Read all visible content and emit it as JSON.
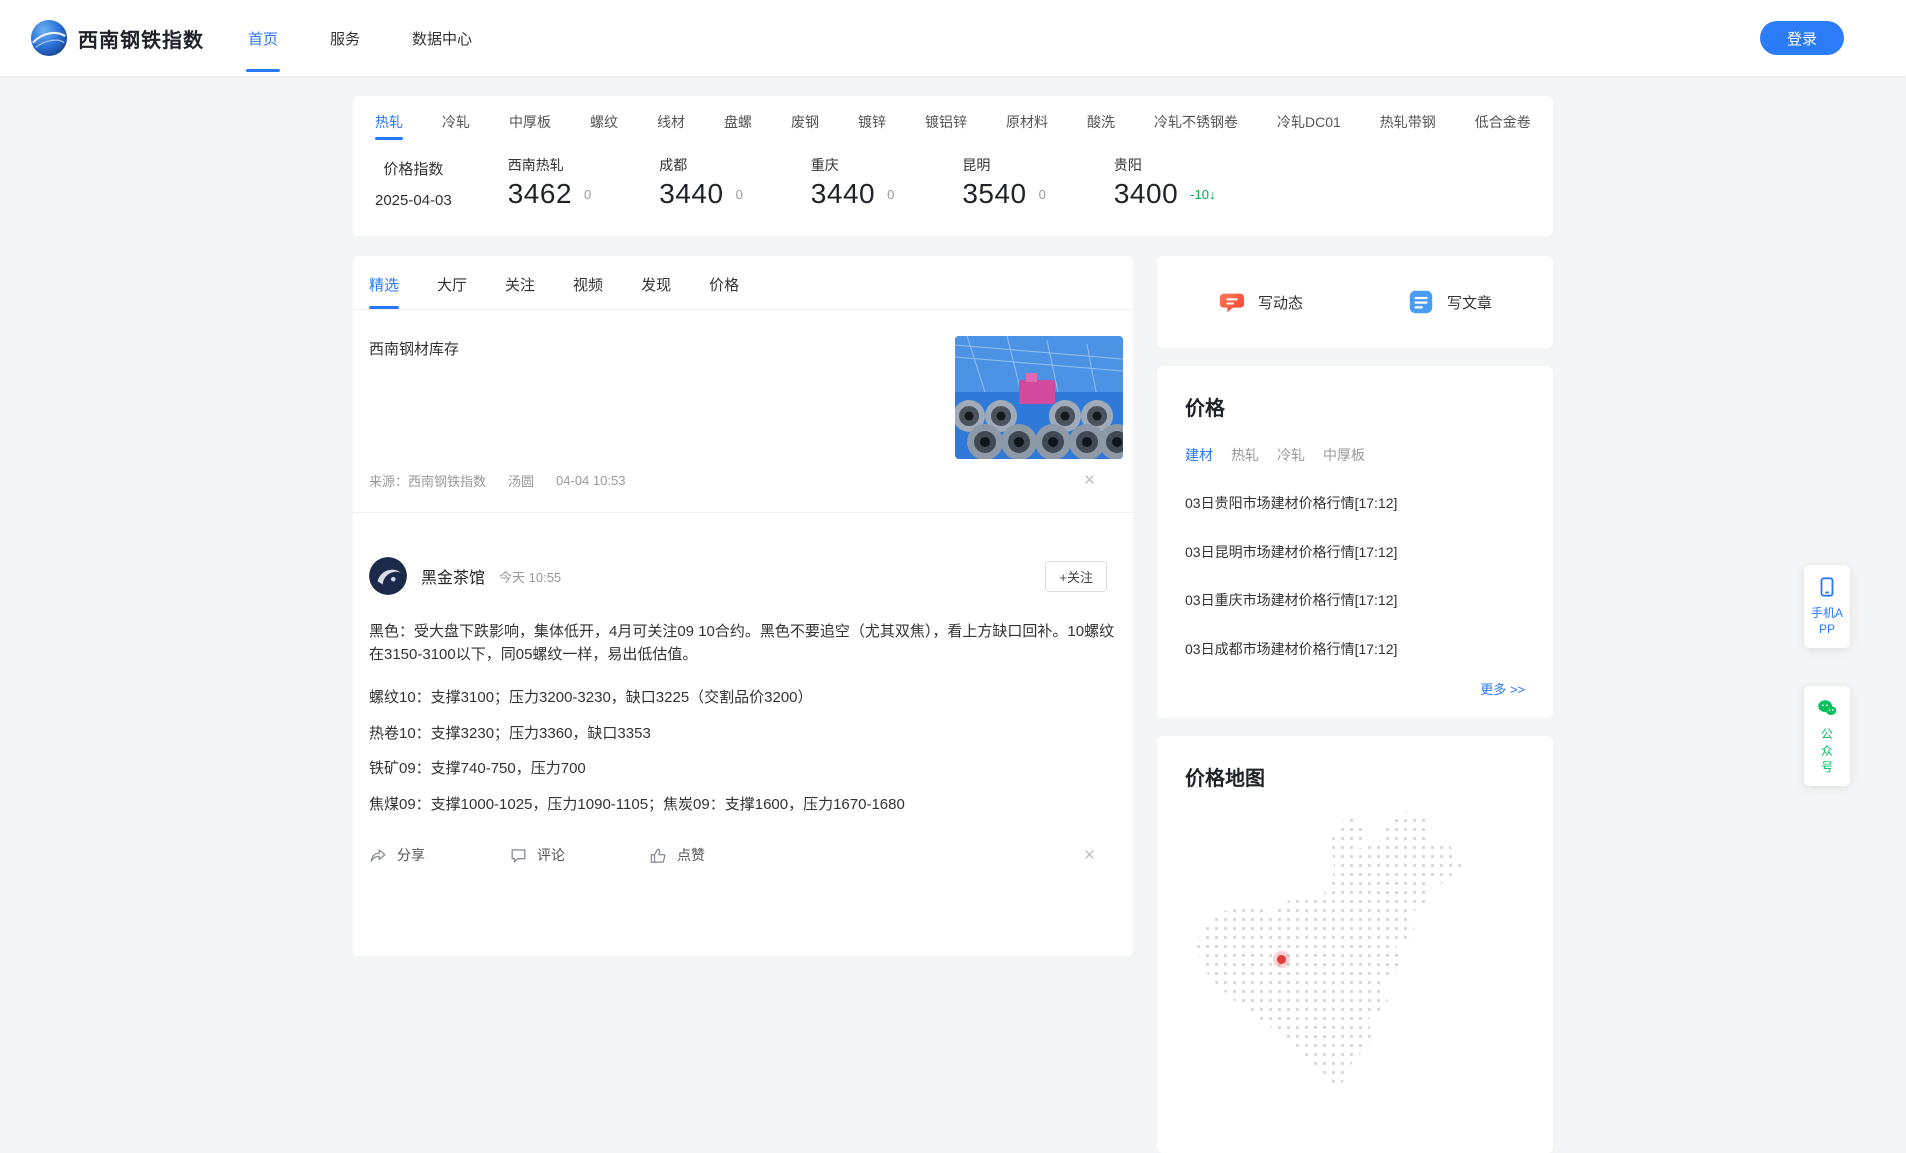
{
  "colors": {
    "primary": "#2878ff",
    "login_blue": "#2b7cf6",
    "down_green": "#00a84f",
    "wechat_green": "#07c160",
    "compose_red": "#f5432e"
  },
  "navbar": {
    "brand": "西南钢铁指数",
    "items": [
      {
        "label": "首页"
      },
      {
        "label": "服务"
      },
      {
        "label": "数据中心"
      }
    ],
    "login_label": "登录"
  },
  "index_card": {
    "tabs": [
      "热轧",
      "冷轧",
      "中厚板",
      "螺纹",
      "线材",
      "盘螺",
      "废钢",
      "镀锌",
      "镀铝锌",
      "原材料",
      "酸洗",
      "冷轧不锈钢卷",
      "冷轧DC01",
      "热轧带钢",
      "低合金卷"
    ],
    "active_tab": "热轧",
    "label_title": "价格指数",
    "label_date": "2025-04-03",
    "prices": [
      {
        "city": "西南热轧",
        "value": "3462",
        "change": "0"
      },
      {
        "city": "成都",
        "value": "3440",
        "change": "0"
      },
      {
        "city": "重庆",
        "value": "3440",
        "change": "0"
      },
      {
        "city": "昆明",
        "value": "3540",
        "change": "0"
      },
      {
        "city": "贵阳",
        "value": "3400",
        "change": "-10↓"
      }
    ]
  },
  "feed": {
    "tabs": [
      "精选",
      "大厅",
      "关注",
      "视频",
      "发现",
      "价格"
    ],
    "active_tab": "精选",
    "article": {
      "title": "西南钢材库存",
      "source": "来源：西南钢铁指数",
      "author": "汤圆",
      "time": "04-04 10:53"
    },
    "post": {
      "user": "黑金茶馆",
      "time": "今天 10:55",
      "follow_label": "+关注",
      "paragraphs": [
        "黑色：受大盘下跌影响，集体低开，4月可关注09 10合约。黑色不要追空（尤其双焦），看上方缺口回补。10螺纹在3150-3100以下，同05螺纹一样，易出低估值。",
        "螺纹10：支撑3100；压力3200-3230，缺口3225（交割品价3200）",
        "热卷10：支撑3230；压力3360，缺口3353",
        "铁矿09：支撑740-750，压力700",
        "焦煤09：支撑1000-1025，压力1090-1105；焦炭09：支撑1600，压力1670-1680"
      ],
      "share_label": "分享",
      "comment_label": "评论",
      "like_label": "点赞"
    }
  },
  "sidebar": {
    "compose": {
      "moment_label": "写动态",
      "article_label": "写文章"
    },
    "price_card": {
      "title": "价格",
      "tabs": [
        "建材",
        "热轧",
        "冷轧",
        "中厚板"
      ],
      "active_tab": "建材",
      "items": [
        "03日贵阳市场建材价格行情[17:12]",
        "03日昆明市场建材价格行情[17:12]",
        "03日重庆市场建材价格行情[17:12]",
        "03日成都市场建材价格行情[17:12]"
      ],
      "more_label": "更多 >>"
    },
    "map_card": {
      "title": "价格地图"
    }
  },
  "floating": {
    "app_label": "手机APP",
    "wechat_label": "公众号"
  },
  "icons": {
    "close": "×"
  }
}
